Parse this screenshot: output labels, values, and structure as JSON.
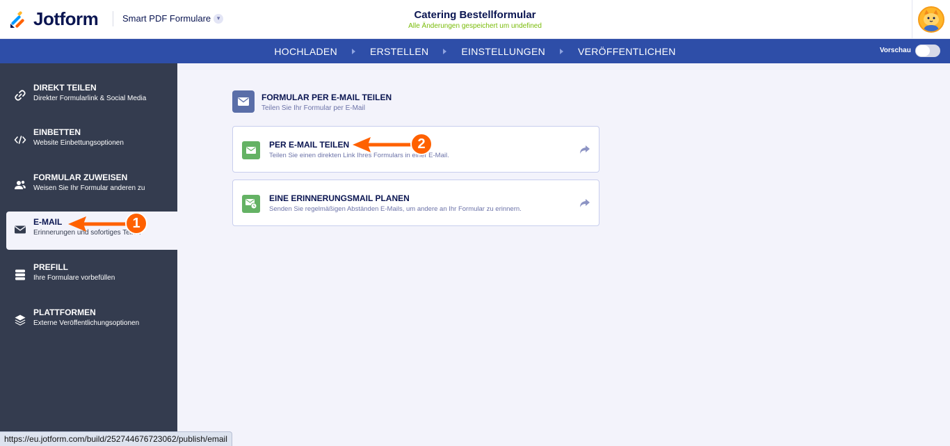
{
  "header": {
    "brand": "Jotform",
    "product": "Smart PDF Formulare",
    "form_title": "Catering Bestellformular",
    "save_status": "Alle Änderungen gespeichert um undefined"
  },
  "nav": {
    "items": [
      "HOCHLADEN",
      "ERSTELLEN",
      "EINSTELLUNGEN",
      "VERÖFFENTLICHEN"
    ],
    "preview_label": "Vorschau",
    "preview_on": false
  },
  "sidebar": {
    "items": [
      {
        "title": "DIREKT TEILEN",
        "subtitle": "Direkter Formularlink & Social Media",
        "icon": "link-icon"
      },
      {
        "title": "EINBETTEN",
        "subtitle": "Website Einbettungsoptionen",
        "icon": "code-icon"
      },
      {
        "title": "FORMULAR ZUWEISEN",
        "subtitle": "Weisen Sie Ihr Formular anderen zu",
        "icon": "users-icon"
      },
      {
        "title": "E-MAIL",
        "subtitle": "Erinnerungen und sofortiges Teilen",
        "icon": "envelope-icon",
        "active": true
      },
      {
        "title": "PREFILL",
        "subtitle": "Ihre Formulare vorbefüllen",
        "icon": "database-icon"
      },
      {
        "title": "PLATTFORMEN",
        "subtitle": "Externe Veröffentlichungsoptionen",
        "icon": "layers-icon"
      }
    ]
  },
  "main": {
    "section_title": "FORMULAR PER E-MAIL TEILEN",
    "section_subtitle": "Teilen Sie Ihr Formular per E-Mail",
    "cards": [
      {
        "title": "PER E-MAIL TEILEN",
        "subtitle": "Teilen Sie einen direkten Link Ihres Formulars in einer E-Mail.",
        "icon": "envelope-icon"
      },
      {
        "title": "EINE ERINNERUNGSMAIL PLANEN",
        "subtitle": "Senden Sie regelmäßigen Abständen E-Mails, um andere an Ihr Formular zu erinnern.",
        "icon": "scheduled-mail-icon"
      }
    ]
  },
  "annotations": {
    "badge_1": "1",
    "badge_2": "2"
  },
  "statusbar": {
    "url": "https://eu.jotform.com/build/252744676723062/publish/email"
  },
  "colors": {
    "navbar": "#2e4ea8",
    "sidebar": "#343c4f",
    "accent_orange": "#ff6100",
    "card_icon_green": "#64b264",
    "saved_green": "#78bb07"
  }
}
